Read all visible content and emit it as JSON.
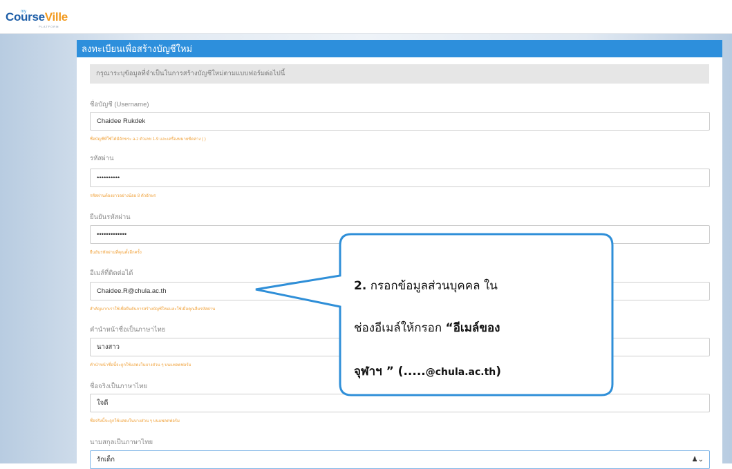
{
  "brand": {
    "small": "my",
    "main_a": "Course",
    "main_b": "Ville",
    "sub": "PLATFORM"
  },
  "panel": {
    "title": "ลงทะเบียนเพื่อสร้างบัญชีใหม่",
    "notice": "กรุณาระบุข้อมูลที่จำเป็นในการสร้างบัญชีใหม่ตามแบบฟอร์มต่อไปนี้"
  },
  "fields": {
    "username": {
      "label": "ชื่อบัญชี (Username)",
      "value": "Chaidee Rukdek",
      "hint": "ชื่อบัญชีที่ใช้ได้มีอักขระ a-z ตัวเลข 1-9 และเครื่องหมายขีดล่าง ( )"
    },
    "password": {
      "label": "รหัสผ่าน",
      "value": "••••••••••",
      "hint": "รหัสผ่านต้องยาวอย่างน้อย 8 ตัวอักษร"
    },
    "confirm": {
      "label": "ยืนยันรหัสผ่าน",
      "value": "•••••••••••••",
      "hint": "ยืนยันรหัสผ่านที่คุณตั้งอีกครั้ง"
    },
    "email": {
      "label": "อีเมล์ที่ติดต่อได้",
      "value": "Chaidee.R@chula.ac.th",
      "hint": "สำคัญมากเราใช้เพื่อยืนยันการสร้างบัญชีใหม่และใช้เมื่อคุณลืมรหัสผ่าน"
    },
    "prefix": {
      "label": "คำนำหน้าชื่อเป็นภาษาไทย",
      "value": "นางสาว",
      "hint": "คำนำหน้าชื่อนี้จะถูกใช้แสดงในบางส่วน ๆ บนแพลตฟอร์ม"
    },
    "firstname": {
      "label": "ชื่อจริงเป็นภาษาไทย",
      "value": "ใจดี",
      "hint": "ชื่อจริงนี้จะถูกใช้แสดงในบางส่วน ๆ บนแพลตฟอร์ม"
    },
    "lastname": {
      "label": "นามสกุลเป็นภาษาไทย",
      "value": "รักเด็ก"
    }
  },
  "callout": {
    "num": "2.",
    "l1": "กรอกข้อมูลส่วนบุคคล ใน",
    "l2a": "ช่องอีเมล์ให้กรอก ",
    "l2b": "“อีเมล์ของ",
    "l3a": "จุฬาฯ ” (.....",
    "l3b": "@chula.ac.th",
    "l3c": ")"
  },
  "icons": {
    "lastname_field": "user-dropdown-icon"
  },
  "colors": {
    "header": "#2d8fdc",
    "hint": "#f0a23b",
    "callout_border": "#2f8fd8"
  }
}
